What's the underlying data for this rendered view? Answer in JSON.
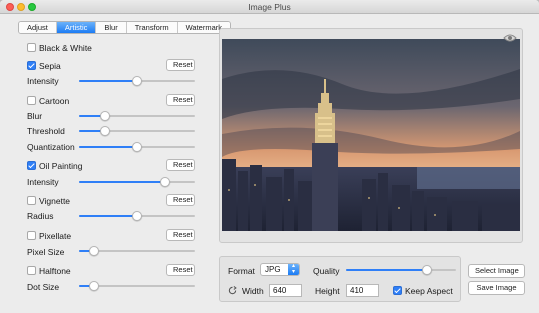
{
  "window": {
    "title": "Image Plus"
  },
  "tabs": [
    {
      "label": "Adjust",
      "active": false
    },
    {
      "label": "Artistic",
      "active": true
    },
    {
      "label": "Blur",
      "active": false
    },
    {
      "label": "Transform",
      "active": false
    },
    {
      "label": "Watermark",
      "active": false
    }
  ],
  "effects": {
    "black_white": {
      "label": "Black & White",
      "checked": false
    },
    "sepia": {
      "label": "Sepia",
      "checked": true,
      "reset": "Reset",
      "params": [
        {
          "label": "Intensity",
          "value": 0.5
        }
      ]
    },
    "cartoon": {
      "label": "Cartoon",
      "checked": false,
      "reset": "Reset",
      "params": [
        {
          "label": "Blur",
          "value": 0.22
        },
        {
          "label": "Threshold",
          "value": 0.22
        },
        {
          "label": "Quantization",
          "value": 0.5
        }
      ]
    },
    "oil_painting": {
      "label": "Oil Painting",
      "checked": true,
      "reset": "Reset",
      "params": [
        {
          "label": "Intensity",
          "value": 0.74
        }
      ]
    },
    "vignette": {
      "label": "Vignette",
      "checked": false,
      "reset": "Reset",
      "params": [
        {
          "label": "Radius",
          "value": 0.5
        }
      ]
    },
    "pixellate": {
      "label": "Pixellate",
      "checked": false,
      "reset": "Reset",
      "params": [
        {
          "label": "Pixel Size",
          "value": 0.13
        }
      ]
    },
    "halftone": {
      "label": "Halftone",
      "checked": false,
      "reset": "Reset",
      "params": [
        {
          "label": "Dot Size",
          "value": 0.13
        }
      ]
    }
  },
  "export": {
    "format_label": "Format",
    "format_value": "JPG",
    "quality_label": "Quality",
    "quality_value": 0.74,
    "width_label": "Width",
    "width_value": "640",
    "height_label": "Height",
    "height_value": "410",
    "keep_aspect_label": "Keep Aspect",
    "keep_aspect_checked": true,
    "select_image": "Select Image",
    "save_image": "Save Image"
  },
  "icons": {
    "preview": "eye-icon",
    "link": "link-icon",
    "select_arrows": "chevron-updown-icon"
  },
  "colors": {
    "accent": "#2f7ff7"
  }
}
